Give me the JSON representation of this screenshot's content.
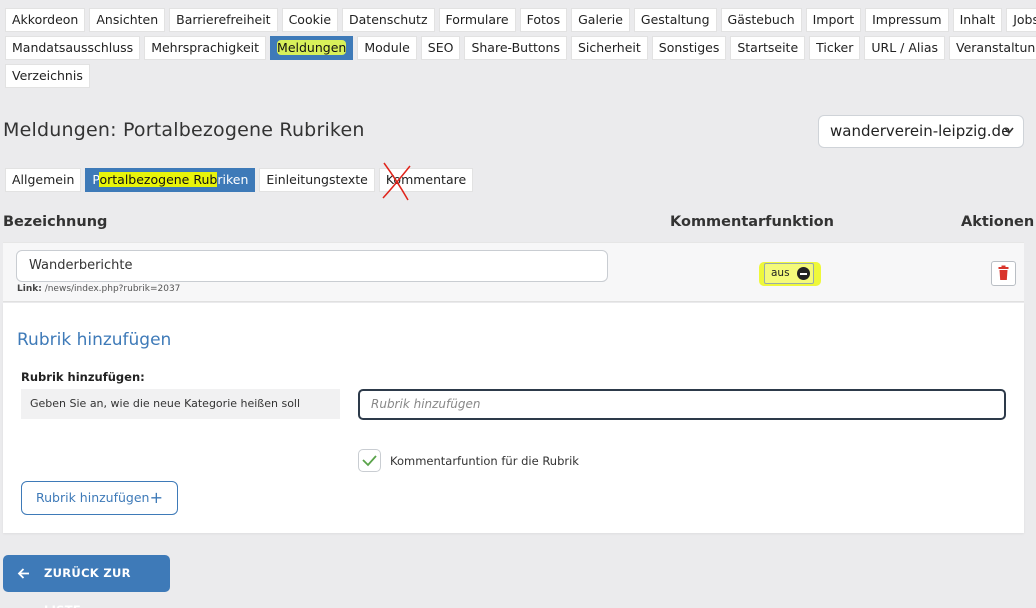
{
  "topnav": {
    "row1": [
      "Akkordeon",
      "Ansichten",
      "Barrierefreiheit",
      "Cookie",
      "Datenschutz",
      "Formulare",
      "Fotos",
      "Galerie",
      "Gestaltung",
      "Gästebuch",
      "Import",
      "Impressum",
      "Inhalt",
      "Jobs"
    ],
    "row2": [
      "Mandatsausschluss",
      "Mehrsprachigkeit",
      "Meldungen",
      "Module",
      "SEO",
      "Share-Buttons",
      "Sicherheit",
      "Sonstiges",
      "Startseite",
      "Ticker",
      "URL / Alias",
      "Veranstaltungen"
    ],
    "row3": [
      "Verzeichnis"
    ],
    "active": "Meldungen"
  },
  "page": {
    "title": "Meldungen: Portalbezogene Rubriken",
    "site_select": "wanderverein-leipzig.de"
  },
  "subtabs": {
    "allgemein": "Allgemein",
    "portal": "Portalbezogene Rubriken",
    "einleitung": "Einleitungstexte",
    "kommentare": "Kommentare"
  },
  "table": {
    "headers": {
      "bezeichnung": "Bezeichnung",
      "kommentarfunktion": "Kommentarfunktion",
      "aktionen": "Aktionen"
    },
    "rows": [
      {
        "name": "Wanderberichte",
        "link_label": "Link:",
        "link": "/news/index.php?rubrik=2037",
        "comment_toggle": "aus"
      }
    ]
  },
  "add_form": {
    "title": "Rubrik hinzufügen",
    "field_label": "Rubrik hinzufügen:",
    "help": "Geben Sie an, wie die neue Kategorie heißen soll",
    "placeholder": "Rubrik hinzufügen",
    "checkbox_label": "Kommentarfuntion für die Rubrik",
    "submit": "Rubrik hinzufügen"
  },
  "back_button": "ZURÜCK ZUR LISTE",
  "colors": {
    "accent": "#3e7ab8",
    "highlight": "#e8f40a",
    "danger": "#d9342b",
    "check": "#5aa34a"
  },
  "icons": {
    "select": "chevron-down-icon",
    "delete": "trash-icon",
    "toggle": "minus-circle-icon",
    "checkbox": "checkmark-icon",
    "add": "plus-icon",
    "back": "arrow-left-icon",
    "annotation": "red-x-mark"
  }
}
